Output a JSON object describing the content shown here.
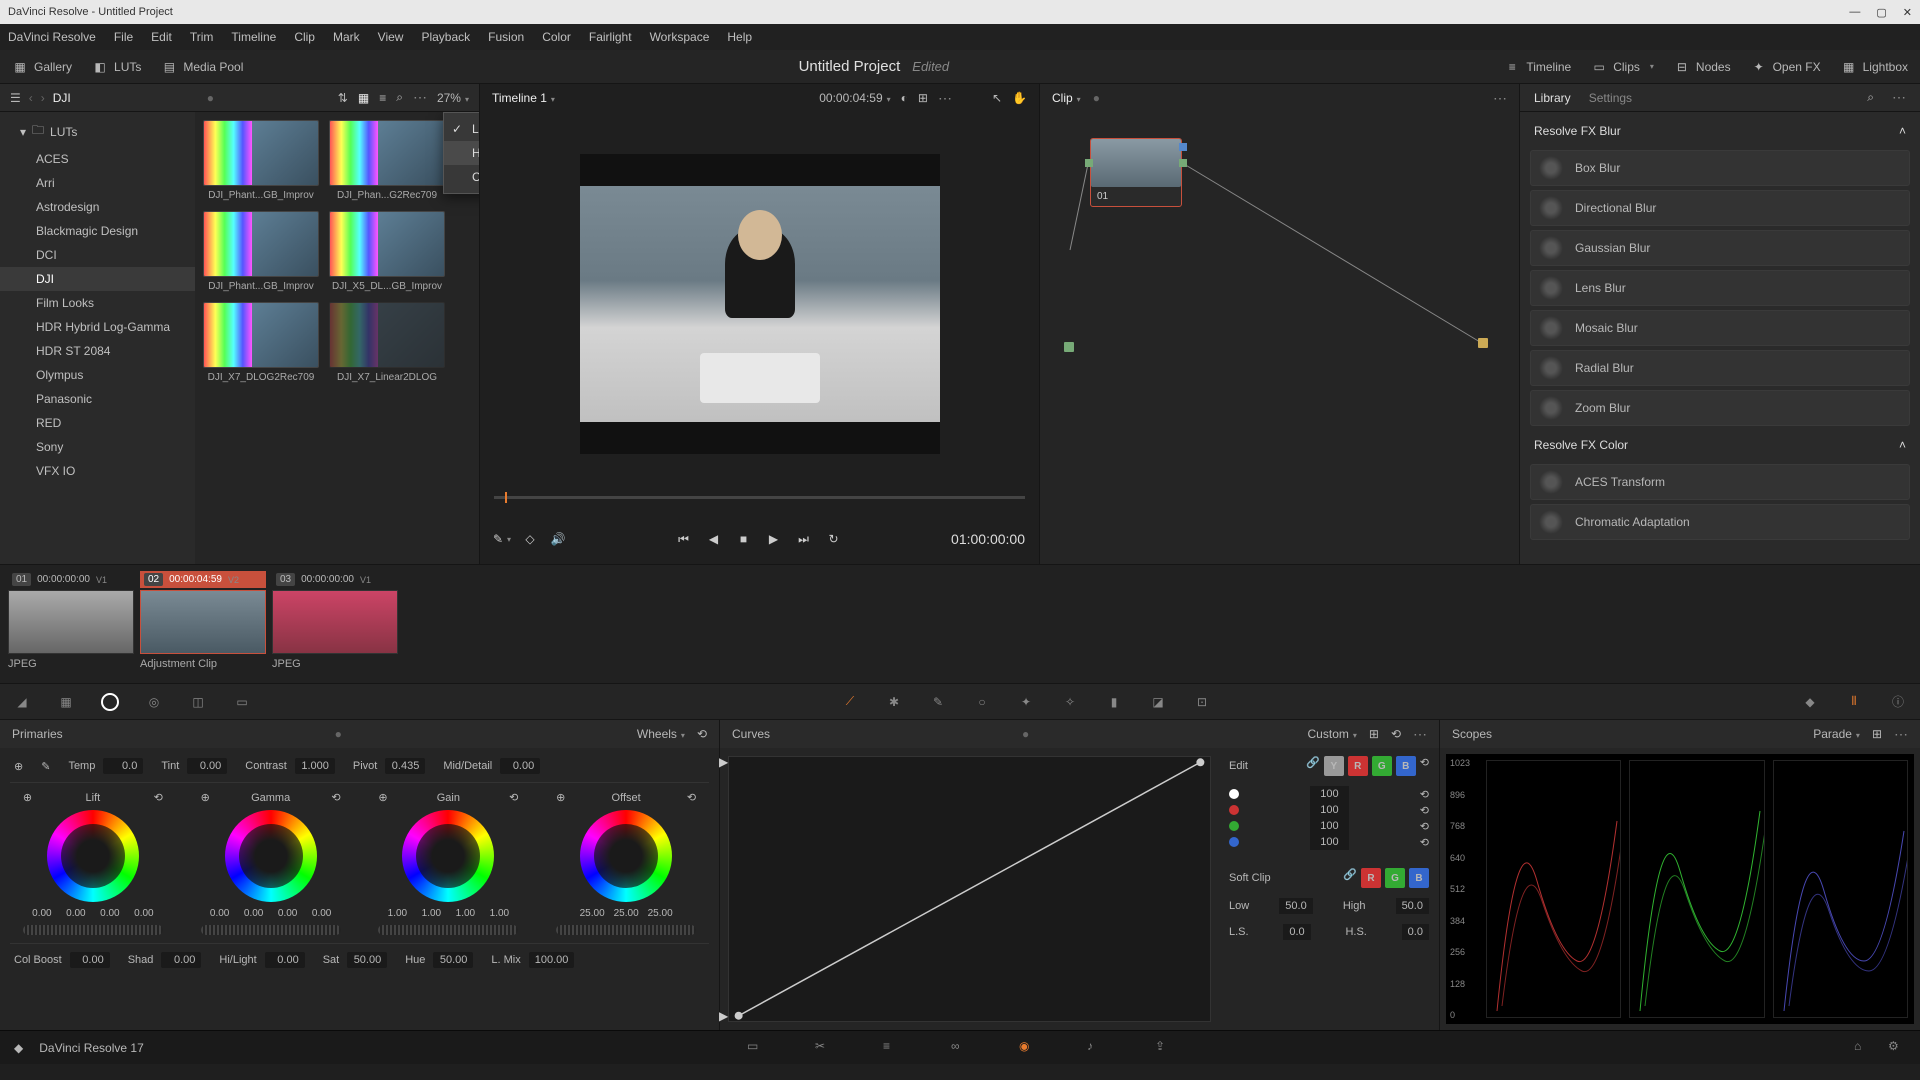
{
  "window": {
    "title": "DaVinci Resolve - Untitled Project"
  },
  "menubar": [
    "DaVinci Resolve",
    "File",
    "Edit",
    "Trim",
    "Timeline",
    "Clip",
    "Mark",
    "View",
    "Playback",
    "Fusion",
    "Color",
    "Fairlight",
    "Workspace",
    "Help"
  ],
  "toolbar": {
    "gallery": "Gallery",
    "luts": "LUTs",
    "mediapool": "Media Pool",
    "timeline": "Timeline",
    "clips": "Clips",
    "nodes": "Nodes",
    "openfx": "Open FX",
    "lightbox": "Lightbox"
  },
  "project": {
    "title": "Untitled Project",
    "status": "Edited"
  },
  "luts_panel": {
    "breadcrumb": "DJI",
    "zoom": "27%",
    "tree_root": "LUTs",
    "tree": [
      "ACES",
      "Arri",
      "Astrodesign",
      "Blackmagic Design",
      "DCI",
      "DJI",
      "Film Looks",
      "HDR Hybrid Log-Gamma",
      "HDR ST 2084",
      "Olympus",
      "Panasonic",
      "RED",
      "Sony",
      "VFX IO"
    ],
    "tree_selected": "DJI",
    "thumbs": [
      {
        "label": "DJI_Phant...GB_Improv"
      },
      {
        "label": "DJI_Phan...G2Rec709"
      },
      {
        "label": "DJI_Phant...GB_Improv"
      },
      {
        "label": "DJI_X5_DL...GB_Improv"
      },
      {
        "label": "DJI_X7_DLOG2Rec709"
      },
      {
        "label": "DJI_X7_Linear2DLOG"
      }
    ],
    "context_menu": [
      {
        "label": "Live Preview",
        "checked": true
      },
      {
        "label": "Hover Scrub Preview",
        "submenu": true,
        "hover": true
      },
      {
        "label": "Change PowerGrades Path..."
      }
    ]
  },
  "viewer": {
    "timeline_label": "Timeline 1",
    "record_tc": "00:00:04:59",
    "source_tc": "01:00:00:00"
  },
  "nodes": {
    "header": "Clip",
    "node_label": "01"
  },
  "library": {
    "tabs": {
      "library": "Library",
      "settings": "Settings"
    },
    "sections": [
      {
        "title": "Resolve FX Blur",
        "items": [
          "Box Blur",
          "Directional Blur",
          "Gaussian Blur",
          "Lens Blur",
          "Mosaic Blur",
          "Radial Blur",
          "Zoom Blur"
        ]
      },
      {
        "title": "Resolve FX Color",
        "items": [
          "ACES Transform",
          "Chromatic Adaptation"
        ]
      }
    ]
  },
  "clips": [
    {
      "num": "01",
      "tc": "00:00:00:00",
      "track": "V1",
      "type": "JPEG"
    },
    {
      "num": "02",
      "tc": "00:00:04:59",
      "track": "V2",
      "type": "Adjustment Clip",
      "selected": true
    },
    {
      "num": "03",
      "tc": "00:00:00:00",
      "track": "V1",
      "type": "JPEG"
    }
  ],
  "primaries": {
    "title": "Primaries",
    "mode": "Wheels",
    "top_sliders": [
      {
        "name": "Temp",
        "val": "0.0"
      },
      {
        "name": "Tint",
        "val": "0.00"
      },
      {
        "name": "Contrast",
        "val": "1.000"
      },
      {
        "name": "Pivot",
        "val": "0.435"
      },
      {
        "name": "Mid/Detail",
        "val": "0.00"
      }
    ],
    "wheels": [
      {
        "name": "Lift",
        "vals": [
          "0.00",
          "0.00",
          "0.00",
          "0.00"
        ]
      },
      {
        "name": "Gamma",
        "vals": [
          "0.00",
          "0.00",
          "0.00",
          "0.00"
        ]
      },
      {
        "name": "Gain",
        "vals": [
          "1.00",
          "1.00",
          "1.00",
          "1.00"
        ]
      },
      {
        "name": "Offset",
        "vals": [
          "25.00",
          "25.00",
          "25.00"
        ]
      }
    ],
    "bottom_sliders": [
      {
        "name": "Col Boost",
        "val": "0.00"
      },
      {
        "name": "Shad",
        "val": "0.00"
      },
      {
        "name": "Hi/Light",
        "val": "0.00"
      },
      {
        "name": "Sat",
        "val": "50.00"
      },
      {
        "name": "Hue",
        "val": "50.00"
      },
      {
        "name": "L. Mix",
        "val": "100.00"
      }
    ]
  },
  "curves": {
    "title": "Curves",
    "mode": "Custom",
    "edit_label": "Edit",
    "softclip_label": "Soft Clip",
    "channels": [
      {
        "dot": "#fff",
        "val": "100"
      },
      {
        "dot": "#c33",
        "val": "100"
      },
      {
        "dot": "#3a3",
        "val": "100"
      },
      {
        "dot": "#36c",
        "val": "100"
      }
    ],
    "softclip": {
      "low_label": "Low",
      "low": "50.0",
      "high_label": "High",
      "high": "50.0",
      "ls_label": "L.S.",
      "ls": "0.0",
      "hs_label": "H.S.",
      "hs": "0.0"
    }
  },
  "scopes": {
    "title": "Scopes",
    "mode": "Parade",
    "scale": [
      "1023",
      "896",
      "768",
      "640",
      "512",
      "384",
      "256",
      "128",
      "0"
    ]
  },
  "footer": {
    "app": "DaVinci Resolve 17"
  }
}
